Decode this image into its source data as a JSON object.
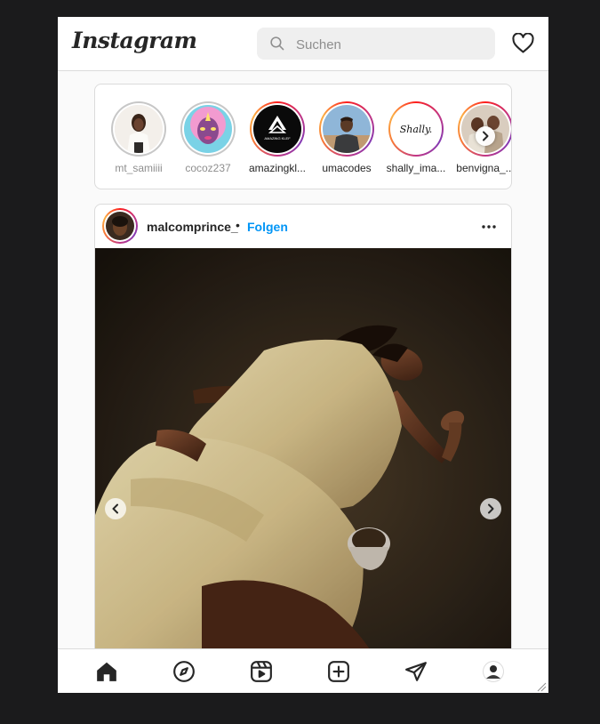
{
  "app": {
    "logo_text": "Instagram",
    "brand_color": "#262626",
    "link_color": "#0095f6"
  },
  "search": {
    "placeholder": "Suchen",
    "value": ""
  },
  "header_icons": [
    "search-icon",
    "heart-icon"
  ],
  "stories": [
    {
      "username": "mt_samiiii",
      "seen": true
    },
    {
      "username": "cocoz237",
      "seen": true
    },
    {
      "username": "amazingkl...",
      "seen": false
    },
    {
      "username": "umacodes",
      "seen": false
    },
    {
      "username": "shally_ima...",
      "seen": false
    },
    {
      "username": "benvigna_...",
      "seen": false
    }
  ],
  "shally_logo_text": "Shally.",
  "amazing_logo_text": "AMAZING KLEF",
  "post": {
    "username": "malcomprince_",
    "separator": "•",
    "follow_label": "Folgen"
  },
  "bottom_nav": [
    "home-icon",
    "explore-icon",
    "reels-icon",
    "create-icon",
    "direct-icon",
    "profile-avatar"
  ]
}
